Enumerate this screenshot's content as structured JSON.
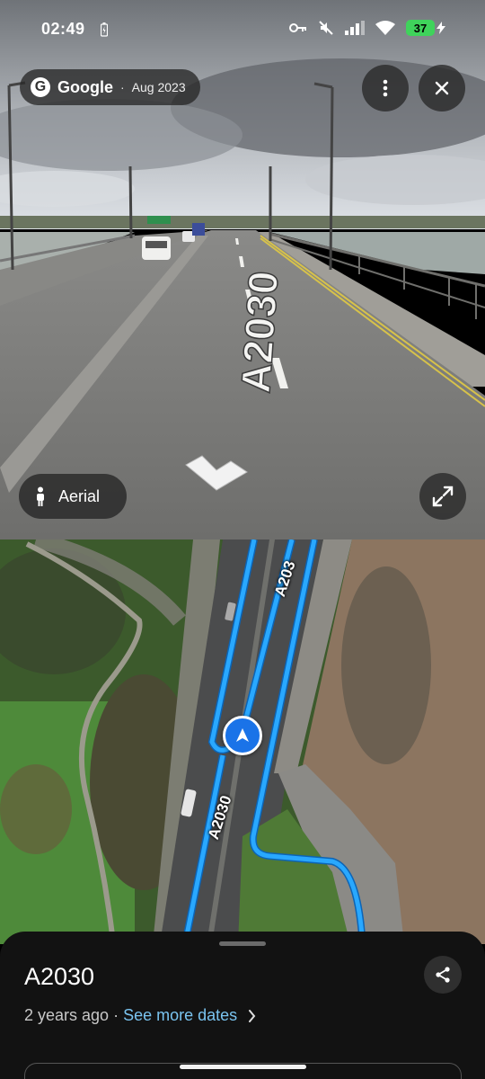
{
  "status_bar": {
    "time": "02:49",
    "battery_level": "37",
    "icons": [
      "battery-saver-icon",
      "key-icon",
      "mute-icon",
      "signal-icon",
      "wifi-icon",
      "battery-icon"
    ]
  },
  "streetview": {
    "source_brand": "Google",
    "separator": "·",
    "capture_date": "Aug 2023",
    "aerial_label": "Aerial",
    "road_marking": "A2030",
    "more_icon": "more-vert-icon",
    "close_icon": "close-icon",
    "expand_icon": "expand-icon",
    "person_icon": "pegman-icon"
  },
  "map": {
    "road_labels": [
      "A203",
      "A2030"
    ],
    "route_color": "#29a8ff",
    "marker_color": "#1a73e8"
  },
  "sheet": {
    "title": "A2030",
    "age": "2 years ago",
    "separator": "·",
    "see_more_dates": "See more dates",
    "link_color": "#7ac4f0"
  }
}
